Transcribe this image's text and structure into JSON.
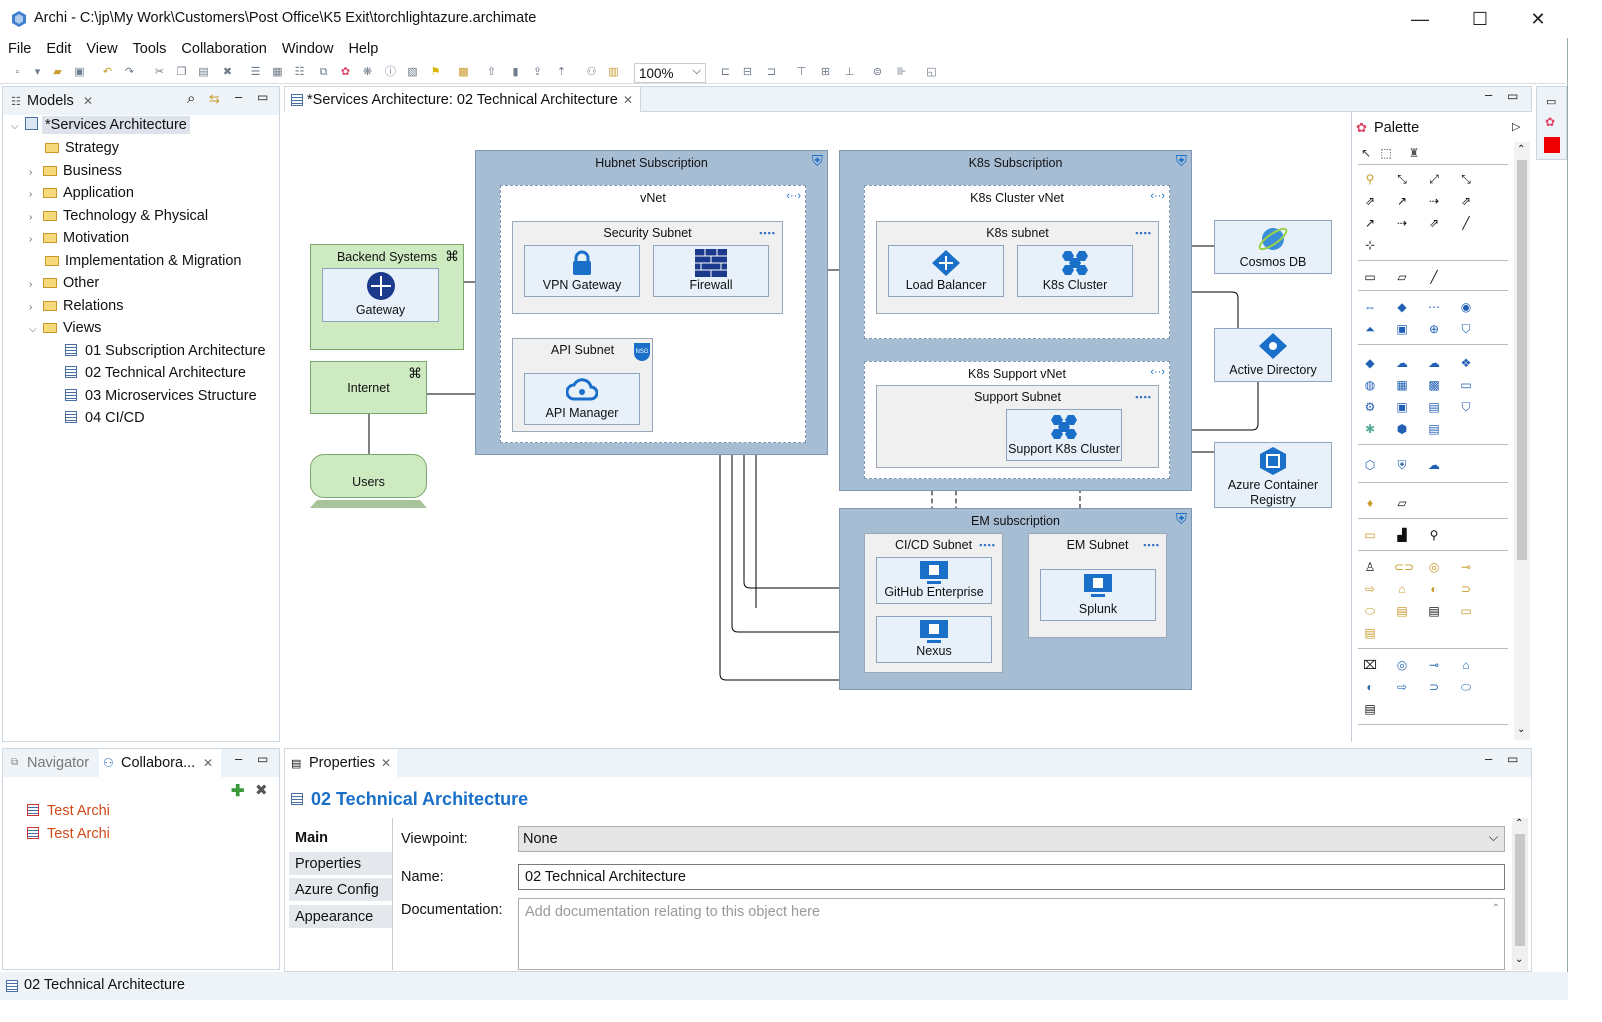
{
  "window": {
    "title": "Archi - C:\\jp\\My Work\\Customers\\Post Office\\K5 Exit\\torchlightazure.archimate",
    "minimize": "—",
    "maximize": "☐",
    "close": "✕"
  },
  "menu": [
    "File",
    "Edit",
    "View",
    "Tools",
    "Collaboration",
    "Window",
    "Help"
  ],
  "toolbar": {
    "zoom": "100%"
  },
  "models_panel": {
    "title": "Models",
    "root": "*Services Architecture",
    "folders": [
      "Strategy",
      "Business",
      "Application",
      "Technology & Physical",
      "Motivation",
      "Implementation & Migration",
      "Other",
      "Relations",
      "Views"
    ],
    "views": [
      "01 Subscription Architecture",
      "02 Technical Architecture",
      "03 Microservices Structure",
      "04 CI/CD"
    ]
  },
  "editor_tab": "*Services Architecture: 02 Technical Architecture",
  "diagram": {
    "hubnet": "Hubnet Subscription",
    "vnet": "vNet",
    "security_subnet": "Security Subnet",
    "vpn_gateway": "VPN Gateway",
    "firewall": "Firewall",
    "api_subnet": "API Subnet",
    "api_manager": "API Manager",
    "backend": "Backend Systems",
    "gateway": "Gateway",
    "internet": "Internet",
    "users": "Users",
    "k8s_sub": "K8s Subscription",
    "k8s_cluster_vnet": "K8s Cluster vNet",
    "k8s_subnet": "K8s subnet",
    "load_balancer": "Load Balancer",
    "k8s_cluster": "K8s Cluster",
    "k8s_support_vnet": "K8s Support vNet",
    "support_subnet": "Support Subnet",
    "support_k8s_cluster": "Support K8s Cluster",
    "cosmos_db": "Cosmos DB",
    "active_directory": "Active Directory",
    "acr": "Azure Container Registry",
    "em_sub": "EM subscription",
    "cicd_subnet": "CI/CD Subnet",
    "em_subnet": "EM Subnet",
    "github": "GitHub Enterprise",
    "nexus": "Nexus",
    "splunk": "Splunk",
    "nsg_badge": "NSG"
  },
  "palette": {
    "title": "Palette"
  },
  "collab_panel": {
    "tabs": [
      "Navigator",
      "Collabora..."
    ],
    "items": [
      "Test Archi",
      "Test Archi"
    ]
  },
  "properties": {
    "tab": "Properties",
    "heading": "02 Technical Architecture",
    "side_tabs": [
      "Main",
      "Properties",
      "Azure Config",
      "Appearance"
    ],
    "viewpoint_label": "Viewpoint:",
    "viewpoint_value": "None",
    "name_label": "Name:",
    "name_value": "02 Technical Architecture",
    "doc_label": "Documentation:",
    "doc_placeholder": "Add documentation relating to this object here"
  },
  "statusbar": "02 Technical Architecture",
  "colors": {
    "accent": "#1a6fc9",
    "group": "#a7bdd4",
    "green": "#cdeac0",
    "node": "#e8f1fa"
  }
}
